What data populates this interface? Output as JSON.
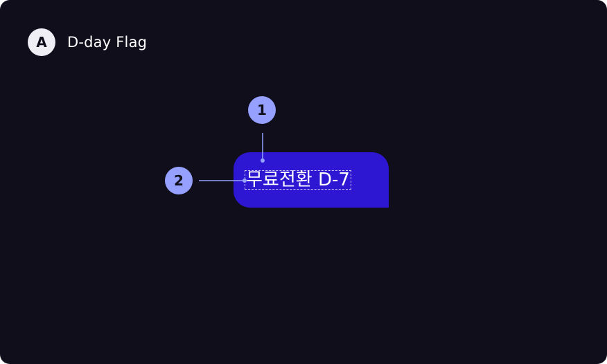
{
  "section": {
    "badge": "A",
    "title": "D-day Flag"
  },
  "flag": {
    "text": "무료전환 D-7",
    "color": "#2e17d3"
  },
  "markers": [
    {
      "label": "1",
      "color": "#95a0ff"
    },
    {
      "label": "2",
      "color": "#95a0ff"
    }
  ]
}
